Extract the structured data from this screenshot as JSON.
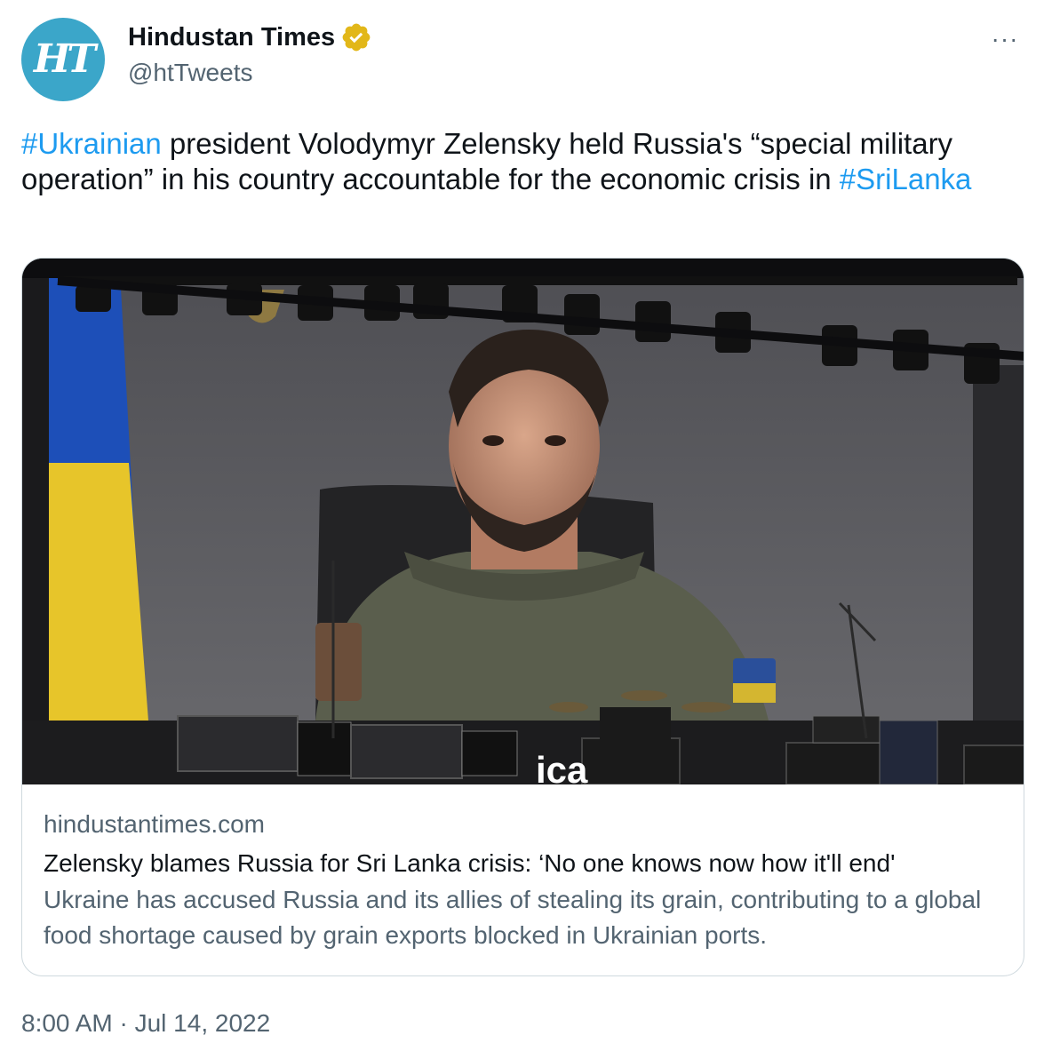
{
  "author": {
    "avatar_text": "HT",
    "name": "Hindustan Times",
    "handle": "@htTweets",
    "verified_icon": "verified-gold-badge-icon",
    "more_icon": "more-options-icon"
  },
  "tweet": {
    "text_parts": {
      "hashtag1": "#Ukrainian",
      "body": " president Volodymyr Zelensky held Russia's “special military operation” in his country accountable for the economic crisis in ",
      "hashtag2": "#SriLanka"
    },
    "timestamp": "8:00 AM · Jul 14, 2022"
  },
  "card": {
    "image_alt": "Zelensky on a large stage screen",
    "screen_text": "ica",
    "domain": "hindustantimes.com",
    "title": "Zelensky blames Russia for Sri Lanka crisis: ‘No one knows now how it'll end'",
    "description": "Ukraine has accused Russia and its allies of stealing its grain, contributing to a global food shortage caused by grain exports blocked in Ukrainian ports."
  },
  "colors": {
    "link": "#1d9bf0",
    "secondary_text": "#536471",
    "avatar_bg": "#3ba6c9",
    "verified_gold": "#e2b719"
  }
}
